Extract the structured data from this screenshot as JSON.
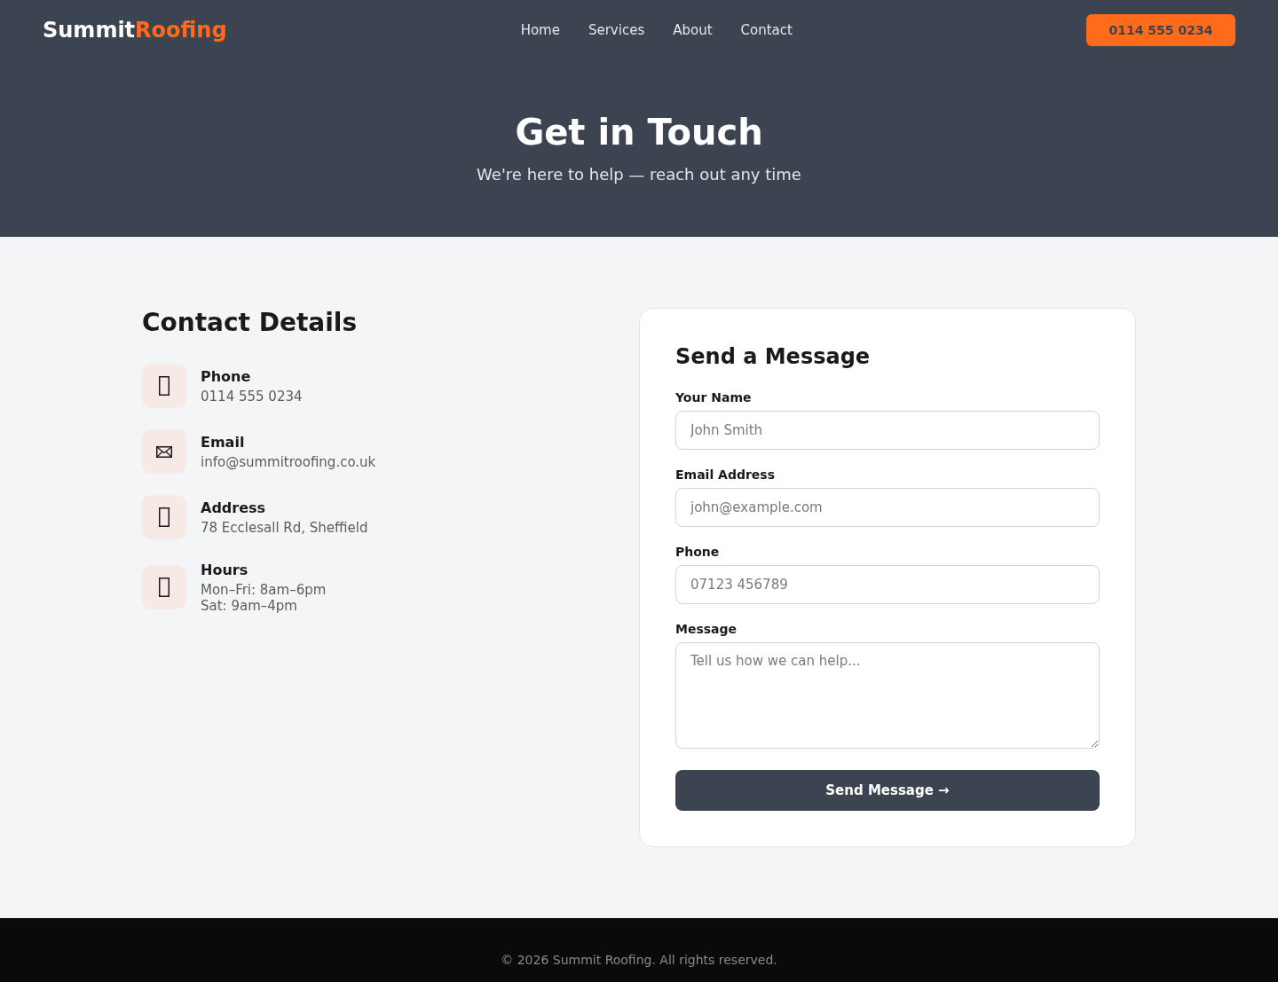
{
  "header": {
    "logo": {
      "primary": "Summit",
      "accent": "Roofing"
    },
    "nav": [
      {
        "label": "Home"
      },
      {
        "label": "Services"
      },
      {
        "label": "About"
      },
      {
        "label": "Contact"
      }
    ],
    "phone_button": "0114 555 0234"
  },
  "hero": {
    "title": "Get in Touch",
    "subtitle": "We're here to help — reach out any time"
  },
  "contact_details": {
    "title": "Contact Details",
    "items": [
      {
        "kind": "phone",
        "label": "Phone",
        "lines": [
          "0114 555 0234"
        ]
      },
      {
        "kind": "email",
        "label": "Email",
        "lines": [
          "info@summitroofing.co.uk"
        ]
      },
      {
        "kind": "address",
        "label": "Address",
        "lines": [
          "78 Ecclesall Rd, Sheffield"
        ]
      },
      {
        "kind": "hours",
        "label": "Hours",
        "lines": [
          "Mon–Fri: 8am–6pm",
          "Sat: 9am–4pm"
        ]
      }
    ]
  },
  "form": {
    "title": "Send a Message",
    "fields": [
      {
        "kind": "input",
        "label": "Your Name",
        "placeholder": "John Smith"
      },
      {
        "kind": "input",
        "label": "Email Address",
        "placeholder": "john@example.com"
      },
      {
        "kind": "input",
        "label": "Phone",
        "placeholder": "07123 456789"
      },
      {
        "kind": "textarea",
        "label": "Message",
        "placeholder": "Tell us how we can help..."
      }
    ],
    "submit": "Send Message →"
  },
  "footer": {
    "text": "© 2026 Summit Roofing. All rights reserved."
  }
}
